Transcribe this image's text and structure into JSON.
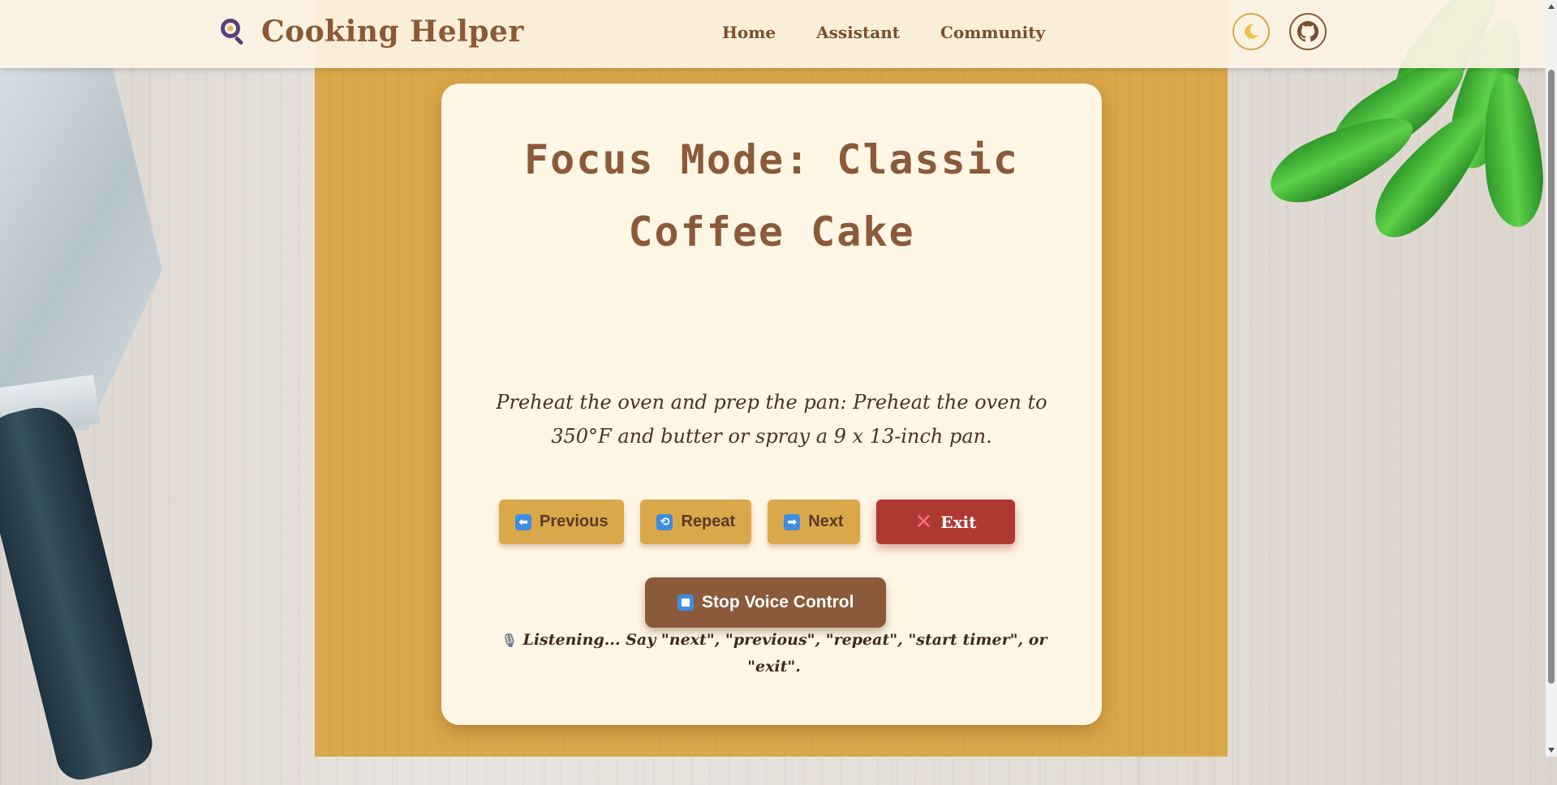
{
  "header": {
    "title": "Cooking Helper",
    "logo_icon": "search-icon",
    "nav": [
      {
        "label": "Home"
      },
      {
        "label": "Assistant"
      },
      {
        "label": "Community"
      }
    ],
    "theme_toggle_icon": "moon-icon",
    "github_icon": "github-icon"
  },
  "focus": {
    "title": "Focus Mode: Classic Coffee Cake",
    "step_text": "Preheat the oven and prep the pan: Preheat the oven to 350°F and butter or spray a 9 x 13-inch pan."
  },
  "controls": {
    "previous_label": "Previous",
    "previous_icon": "left-arrow-icon",
    "repeat_label": "Repeat",
    "repeat_icon": "repeat-icon",
    "next_label": "Next",
    "next_icon": "right-arrow-icon",
    "exit_label": "Exit",
    "exit_icon": "cross-mark-icon"
  },
  "voice": {
    "button_label": "Stop Voice Control",
    "button_icon": "stop-icon",
    "status_icon": "microphone-icon",
    "status_text": "Listening... Say \"next\", \"previous\", \"repeat\", \"start timer\", or \"exit\"."
  },
  "colors": {
    "accent_yellow": "#d9a84a",
    "brown": "#8b5a3a",
    "exit_red": "#ad3a32",
    "card_bg": "#fff6e6"
  }
}
